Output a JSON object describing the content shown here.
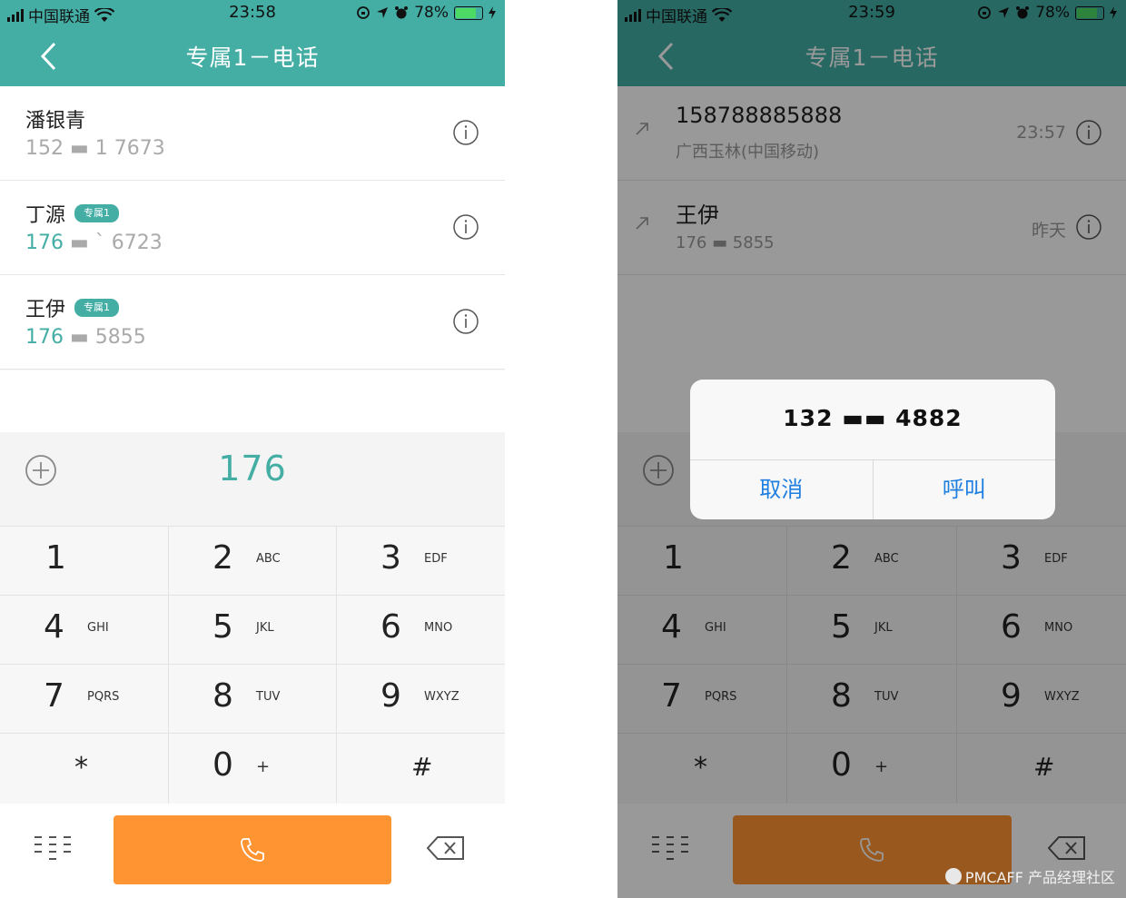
{
  "left": {
    "status": {
      "carrier": "中国联通",
      "time": "23:58",
      "battery": "78%"
    },
    "title": "专属1－电话",
    "contacts": [
      {
        "name": "潘银青",
        "tag": "",
        "number_hl": "",
        "number_rest": "152 ▬  1 7673"
      },
      {
        "name": "丁源",
        "tag": "专属1",
        "number_hl": "176",
        "number_rest": " ▬  ˋ 6723"
      },
      {
        "name": "王伊",
        "tag": "专属1",
        "number_hl": "176",
        "number_rest": " ▬    5855"
      }
    ],
    "dialed": "176",
    "keys": [
      {
        "d": "1",
        "l": ""
      },
      {
        "d": "2",
        "l": "ABC"
      },
      {
        "d": "3",
        "l": "EDF"
      },
      {
        "d": "4",
        "l": "GHI"
      },
      {
        "d": "5",
        "l": "JKL"
      },
      {
        "d": "6",
        "l": "MNO"
      },
      {
        "d": "7",
        "l": "PQRS"
      },
      {
        "d": "8",
        "l": "TUV"
      },
      {
        "d": "9",
        "l": "WXYZ"
      },
      {
        "d": "*",
        "l": ""
      },
      {
        "d": "0",
        "l": "+"
      },
      {
        "d": "#",
        "l": ""
      }
    ]
  },
  "right": {
    "status": {
      "carrier": "中国联通",
      "time": "23:59",
      "battery": "78%"
    },
    "title": "专属1－电话",
    "recents": [
      {
        "title": "158788885888",
        "sub": "广西玉林(中国移动)",
        "when": "23:57"
      },
      {
        "title": "王伊",
        "sub": "176 ▬  5855",
        "when": "昨天"
      }
    ],
    "alert": {
      "message": "132 ▬▬ 4882",
      "cancel": "取消",
      "call": "呼叫"
    },
    "keys": [
      {
        "d": "1",
        "l": ""
      },
      {
        "d": "2",
        "l": "ABC"
      },
      {
        "d": "3",
        "l": "EDF"
      },
      {
        "d": "4",
        "l": "GHI"
      },
      {
        "d": "5",
        "l": "JKL"
      },
      {
        "d": "6",
        "l": "MNO"
      },
      {
        "d": "7",
        "l": "PQRS"
      },
      {
        "d": "8",
        "l": "TUV"
      },
      {
        "d": "9",
        "l": "WXYZ"
      },
      {
        "d": "*",
        "l": ""
      },
      {
        "d": "0",
        "l": "+"
      },
      {
        "d": "#",
        "l": ""
      }
    ],
    "watermark": "PMCAFF 产品经理社区"
  },
  "colors": {
    "accent": "#44aea5",
    "call": "#ff9432",
    "alert_button": "#1f7fe0"
  }
}
